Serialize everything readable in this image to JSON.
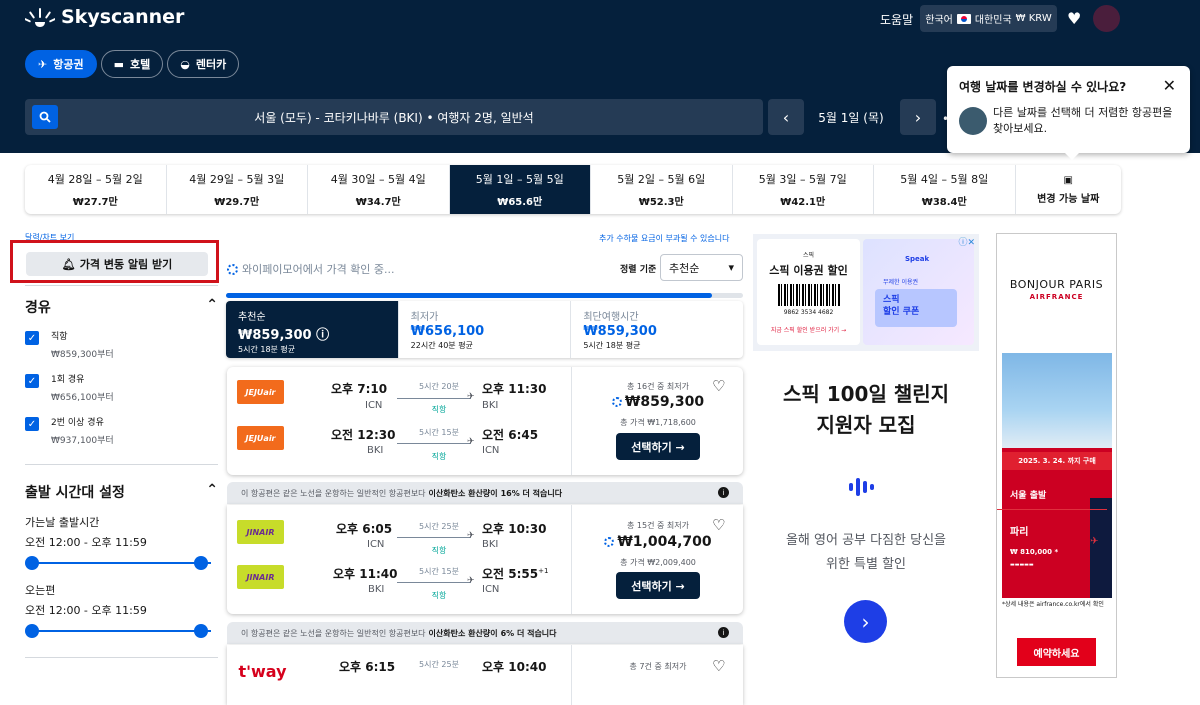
{
  "header": {
    "brand": "Skyscanner",
    "help": "도움말",
    "locale": "한국어",
    "region": "대한민국",
    "currency": "₩ KRW"
  },
  "tabs": [
    {
      "label": "항공권"
    },
    {
      "label": "호텔"
    },
    {
      "label": "렌터카"
    }
  ],
  "search": {
    "summary": "서울 (모두) - 코타키나바루 (BKI) • 여행자 2명, 일반석",
    "date": "5월 1일 (목)"
  },
  "popup": {
    "title": "여행 날짜를 변경하실 수 있나요?",
    "body": "다른 날짜를 선택해 더 저렴한 항공편을 찾아보세요."
  },
  "dates": [
    {
      "range": "4월 28일 – 5월 2일",
      "price": "₩27.7만"
    },
    {
      "range": "4월 29일 – 5월 3일",
      "price": "₩29.7만"
    },
    {
      "range": "4월 30일 – 5월 4일",
      "price": "₩34.7만"
    },
    {
      "range": "5월 1일 – 5월 5일",
      "price": "₩65.6만"
    },
    {
      "range": "5월 2일 – 5월 6일",
      "price": "₩52.3만"
    },
    {
      "range": "5월 3일 – 5월 7일",
      "price": "₩42.1만"
    },
    {
      "range": "5월 4일 – 5월 8일",
      "price": "₩38.4만"
    }
  ],
  "flex_dates": "변경 가능 날짜",
  "sidebar": {
    "calendar_link": "달력/차트 보기",
    "alert_btn": "가격 변동 알림 받기",
    "stops_title": "경유",
    "stops": [
      {
        "label": "직항",
        "price": "₩859,300부터"
      },
      {
        "label": "1회 경유",
        "price": "₩656,100부터"
      },
      {
        "label": "2번 이상 경유",
        "price": "₩937,100부터"
      }
    ],
    "time_title": "출발 시간대 설정",
    "outbound_label": "가는날 출발시간",
    "outbound_range": "오전 12:00 - 오후 11:59",
    "return_label": "오는편",
    "return_range": "오전 12:00 - 오후 11:59"
  },
  "results": {
    "fee_note": "추가 수하물 요금이 부과될 수 있습니다",
    "loading": "와이페이모어에서 가격 확인 중...",
    "sort_label": "정렬 기준",
    "sort_value": "추천순",
    "progress": 0.94,
    "sort_tabs": [
      {
        "label": "추천순",
        "price": "₩859,300",
        "detail": "5시간 18분 평균"
      },
      {
        "label": "최저가",
        "price": "₩656,100",
        "detail": "22시간 40분 평균"
      },
      {
        "label": "최단여행시간",
        "price": "₩859,300",
        "detail": "5시간 18분 평균"
      }
    ],
    "eco_prefix": "이 항공편은 같은 노선을 운항하는 일반적인 항공편보다",
    "eco_mid": "이산화탄소 환산량이",
    "select": "선택하기 →",
    "cards": [
      {
        "airline": "JEJUair",
        "color": "#f26b1c",
        "legs": [
          {
            "dep": "오후 7:10",
            "from": "ICN",
            "dur": "5시간 20분",
            "type": "직항",
            "arr": "오후 11:30",
            "to": "BKI"
          },
          {
            "dep": "오전 12:30",
            "from": "BKI",
            "dur": "5시간 15분",
            "type": "직항",
            "arr": "오전 6:45",
            "to": "ICN"
          }
        ],
        "deals": "총 16건 중 최저가",
        "price": "₩859,300",
        "total": "총 가격 ₩1,718,600"
      },
      {
        "airline": "JINAIR",
        "color": "#c7dc2a",
        "eco": "16% 더 적습니다",
        "legs": [
          {
            "dep": "오후 6:05",
            "from": "ICN",
            "dur": "5시간 25분",
            "type": "직항",
            "arr": "오후 10:30",
            "to": "BKI"
          },
          {
            "dep": "오후 11:40",
            "from": "BKI",
            "dur": "5시간 15분",
            "type": "직항",
            "arr": "오전 5:55",
            "sup": "+1",
            "to": "ICN"
          }
        ],
        "deals": "총 15건 중 최저가",
        "price": "₩1,004,700",
        "total": "총 가격 ₩2,009,400"
      },
      {
        "airline": "t'way",
        "color": "#ffffff",
        "eco": "6% 더 적습니다",
        "legs": [
          {
            "dep": "오후 6:15",
            "from": "ICN",
            "dur": "5시간 25분",
            "type": "직항",
            "arr": "오후 10:40",
            "to": "BKI"
          }
        ],
        "deals": "총 7건 중 최저가"
      }
    ]
  },
  "ad1": {
    "brand": "스픽",
    "coupon_title": "스픽 이용권 할인",
    "barcode": "9862 3534 4682",
    "coupon_link": "지금 스픽 할인 받으러 가기 →",
    "speak": "Speak",
    "badge": "무제한 이용권",
    "badge2": "스픽\n할인 쿠폰",
    "headline1": "스픽 100일 챌린지",
    "headline2": "지원자 모집",
    "sub1": "올해 영어 공부 다짐한 당신을",
    "sub2": "위한 특별 할인"
  },
  "ad2": {
    "brand": "BONJOUR PARIS",
    "airline": "AIRFRANCE",
    "deadline": "2025. 3. 24. 까지 구매",
    "origin": "서울 출발",
    "dest": "파리",
    "price": "₩ 810,000 *",
    "fine": "*상세 내용은 airfrance.co.kr에서 확인",
    "book": "예약하세요"
  }
}
